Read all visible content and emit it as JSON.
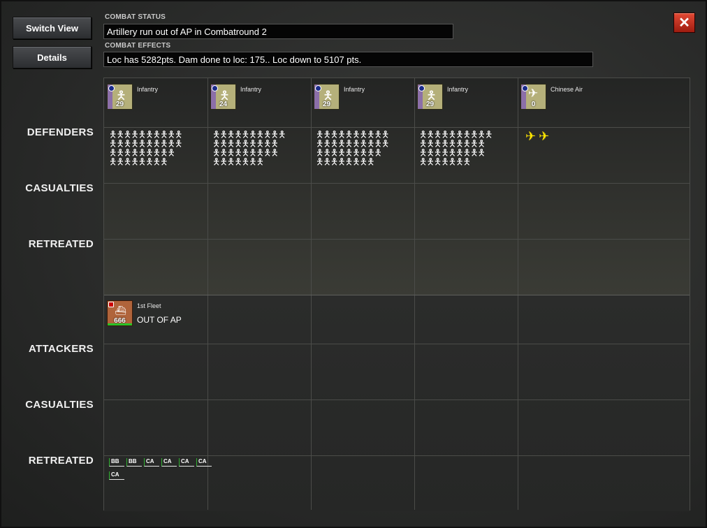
{
  "buttons": {
    "switch_view": "Switch View",
    "details": "Details",
    "close": "✕"
  },
  "combat_status": {
    "label": "COMBAT STATUS",
    "value": "Artillery run out of AP in Combatround  2"
  },
  "combat_effects": {
    "label": "COMBAT EFFECTS",
    "value": "Loc has  5282pts. Dam done to loc: 175.. Loc down to 5107 pts."
  },
  "rows": {
    "defenders": "DEFENDERS",
    "def_casualties": "CASUALTIES",
    "def_retreated": "RETREATED",
    "attackers": "ATTACKERS",
    "att_casualties": "CASUALTIES",
    "att_retreated": "RETREATED"
  },
  "defender_units": [
    {
      "name": "Infantry",
      "strength": "29",
      "icon": "infantry-icon"
    },
    {
      "name": "Infantry",
      "strength": "24",
      "icon": "infantry-icon"
    },
    {
      "name": "Infantry",
      "strength": "29",
      "icon": "infantry-icon"
    },
    {
      "name": "Infantry",
      "strength": "29",
      "icon": "infantry-icon"
    },
    {
      "name": "Chinese Air",
      "strength": "0",
      "icon": "airplane-icon"
    }
  ],
  "attacker_units": [
    {
      "name": "1st Fleet",
      "strength": "666",
      "status": "OUT OF AP",
      "icon": "ship-icon"
    }
  ],
  "retreated_ships": [
    "BB",
    "BB",
    "CA",
    "CA",
    "CA",
    "CA",
    "CA"
  ],
  "colors": {
    "close": "#c8331f",
    "counter_chinese": "#b5b07a",
    "counter_japanese": "#b0643b"
  }
}
